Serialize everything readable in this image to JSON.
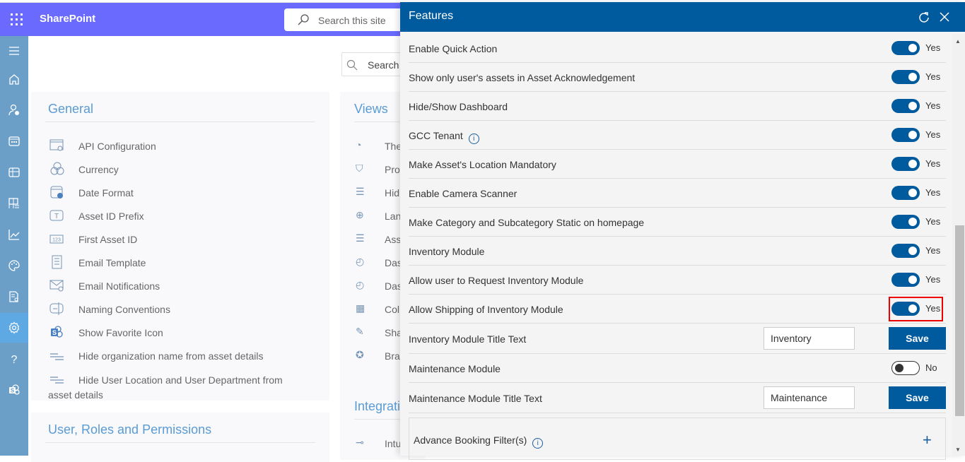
{
  "topbar": {
    "app_name": "SharePoint",
    "search_placeholder": "Search this site"
  },
  "leftnav": {
    "items": [
      {
        "icon": "hamburger-icon"
      },
      {
        "icon": "home-icon"
      },
      {
        "icon": "user-settings-icon"
      },
      {
        "icon": "calendar-icon"
      },
      {
        "icon": "table-icon"
      },
      {
        "icon": "list-grid-icon"
      },
      {
        "icon": "chart-icon"
      },
      {
        "icon": "palette-icon"
      },
      {
        "icon": "report-search-icon"
      },
      {
        "icon": "gear-icon",
        "active": true
      },
      {
        "icon": "help-icon"
      },
      {
        "icon": "sharepoint-icon"
      }
    ]
  },
  "content": {
    "search_placeholder": "Search",
    "general": {
      "title": "General",
      "items": [
        {
          "label": "API Configuration",
          "icon": "api-config-icon"
        },
        {
          "label": "Currency",
          "icon": "currency-icon"
        },
        {
          "label": "Date Format",
          "icon": "date-format-icon"
        },
        {
          "label": "Asset ID Prefix",
          "icon": "text-prefix-icon"
        },
        {
          "label": "First Asset ID",
          "icon": "number-icon"
        },
        {
          "label": "Email Template",
          "icon": "template-icon"
        },
        {
          "label": "Email Notifications",
          "icon": "email-settings-icon"
        },
        {
          "label": "Naming Conventions",
          "icon": "naming-icon"
        },
        {
          "label": "Show Favorite Icon",
          "icon": "sharepoint-icon"
        },
        {
          "label": "Hide organization name from asset details",
          "icon": "lines-icon"
        },
        {
          "label": "Hide User Location and User Department from asset details",
          "icon": "lines-icon"
        }
      ]
    },
    "views": {
      "title": "Views",
      "items": [
        {
          "label": "The",
          "icon": "palette-icon"
        },
        {
          "label": "Pro",
          "icon": "cart-icon"
        },
        {
          "label": "Hid",
          "icon": "lines-icon"
        },
        {
          "label": "Lan",
          "icon": "language-icon"
        },
        {
          "label": "Ass",
          "icon": "lines-icon"
        },
        {
          "label": "Das",
          "icon": "gauge-add-icon"
        },
        {
          "label": "Das",
          "icon": "gauge-add-icon"
        },
        {
          "label": "Col",
          "icon": "column-settings-icon"
        },
        {
          "label": "Sha",
          "icon": "edit-icon"
        },
        {
          "label": "Bra",
          "icon": "badge-check-icon"
        }
      ]
    },
    "user_roles": {
      "title": "User, Roles and Permissions"
    },
    "integrations": {
      "title": "Integrati",
      "items": [
        {
          "label": "Intu",
          "icon": "connector-icon"
        }
      ]
    }
  },
  "panel": {
    "title": "Features",
    "rows": [
      {
        "label": "Enable Quick Action",
        "type": "toggle",
        "on": true,
        "value": "Yes"
      },
      {
        "label": "Show only user's assets in Asset Acknowledgement",
        "type": "toggle",
        "on": true,
        "value": "Yes"
      },
      {
        "label": "Hide/Show Dashboard",
        "type": "toggle",
        "on": true,
        "value": "Yes"
      },
      {
        "label": "GCC Tenant",
        "type": "toggle",
        "on": true,
        "value": "Yes",
        "info": true
      },
      {
        "label": "Make Asset's Location Mandatory",
        "type": "toggle",
        "on": true,
        "value": "Yes"
      },
      {
        "label": "Enable Camera Scanner",
        "type": "toggle",
        "on": true,
        "value": "Yes"
      },
      {
        "label": "Make Category and Subcategory Static on homepage",
        "type": "toggle",
        "on": true,
        "value": "Yes"
      },
      {
        "label": "Inventory Module",
        "type": "toggle",
        "on": true,
        "value": "Yes"
      },
      {
        "label": "Allow user to Request Inventory Module",
        "type": "toggle",
        "on": true,
        "value": "Yes"
      },
      {
        "label": "Allow Shipping of Inventory Module",
        "type": "toggle",
        "on": true,
        "value": "Yes",
        "highlighted": true
      },
      {
        "label": "Inventory Module Title Text",
        "type": "text",
        "input_value": "Inventory",
        "button": "Save"
      },
      {
        "label": "Maintenance Module",
        "type": "toggle",
        "on": false,
        "value": "No"
      },
      {
        "label": "Maintenance Module Title Text",
        "type": "text",
        "input_value": "Maintenance",
        "button": "Save"
      }
    ],
    "advance_booking": {
      "label": "Advance Booking Filter(s)",
      "plus": "+"
    },
    "info_glyph": "i"
  }
}
